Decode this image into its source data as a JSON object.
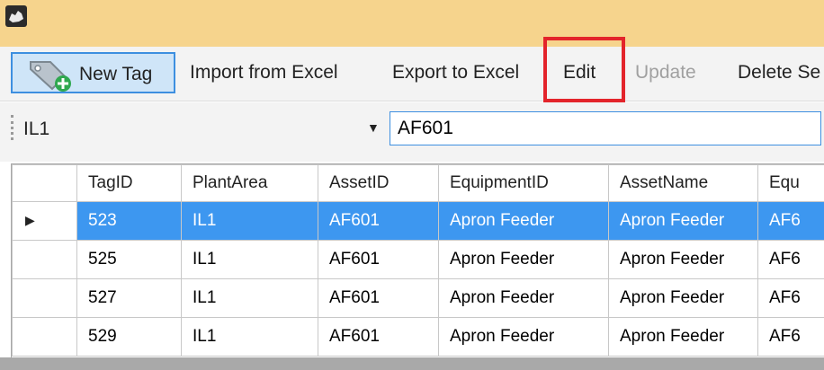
{
  "toolbar": {
    "buttons": {
      "new_tag": "New Tag",
      "import_excel": "Import from Excel",
      "export_excel": "Export to Excel",
      "edit": "Edit",
      "update": "Update",
      "delete_selected": "Delete Se"
    },
    "highlight_color": "#e3242b"
  },
  "filter": {
    "plant_area": "IL1",
    "search_value": "AF601"
  },
  "grid": {
    "columns": [
      "TagID",
      "PlantArea",
      "AssetID",
      "EquipmentID",
      "AssetName",
      "Equ"
    ],
    "rows": [
      [
        "523",
        "IL1",
        "AF601",
        "Apron Feeder",
        "Apron Feeder",
        "AF6"
      ],
      [
        "525",
        "IL1",
        "AF601",
        "Apron Feeder",
        "Apron Feeder",
        "AF6"
      ],
      [
        "527",
        "IL1",
        "AF601",
        "Apron Feeder",
        "Apron Feeder",
        "AF6"
      ],
      [
        "529",
        "IL1",
        "AF601",
        "Apron Feeder",
        "Apron Feeder",
        "AF6"
      ]
    ],
    "selected_row": 0,
    "selection_color": "#3d97f0"
  }
}
